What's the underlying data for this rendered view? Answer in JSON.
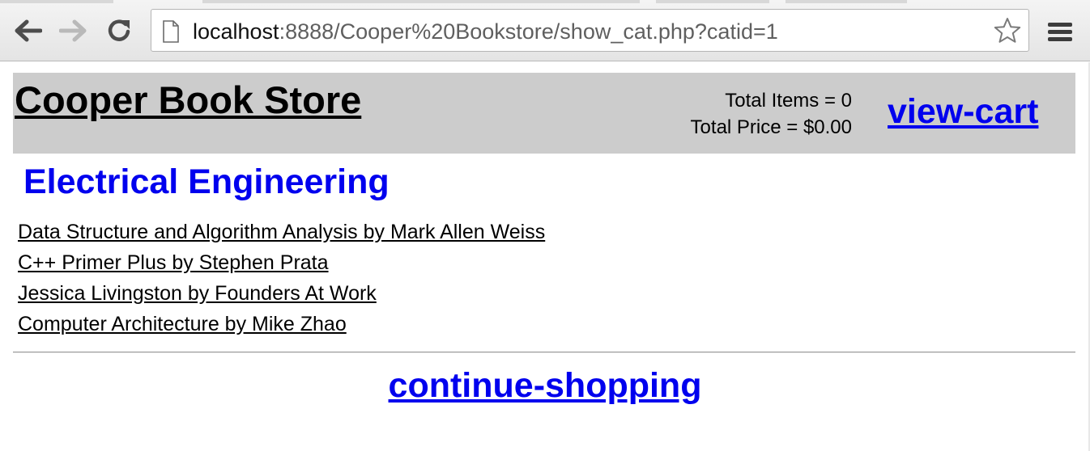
{
  "browser": {
    "url_host": "localhost",
    "url_rest": ":8888/Cooper%20Bookstore/show_cat.php?catid=1",
    "icons": [
      "back-arrow-icon",
      "forward-arrow-icon",
      "reload-icon",
      "page-icon",
      "star-icon",
      "hamburger-menu-icon"
    ]
  },
  "header": {
    "store_title": "Cooper Book Store",
    "total_items": "Total Items = 0",
    "total_price": "Total Price = $0.00",
    "view_cart": "view-cart"
  },
  "category": {
    "title": "Electrical Engineering"
  },
  "books": [
    {
      "label": "Data Structure and Algorithm Analysis by Mark Allen Weiss"
    },
    {
      "label": "C++ Primer Plus by Stephen Prata"
    },
    {
      "label": "Jessica Livingston by Founders At Work"
    },
    {
      "label": "Computer Architecture by Mike Zhao"
    }
  ],
  "footer": {
    "continue_shopping": "continue-shopping"
  },
  "colors": {
    "link_blue": "#0000ee",
    "header_bg": "#cccccc"
  }
}
